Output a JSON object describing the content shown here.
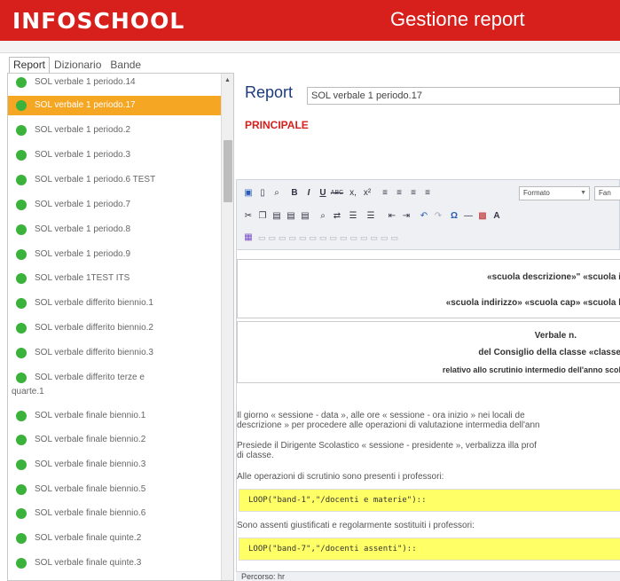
{
  "header": {
    "logo": "INFOSCHOOL",
    "title": "Gestione report",
    "colors": {
      "header_bg": "#d7201c",
      "selected_item": "#f5a623",
      "status_dot": "#3bb23b",
      "code_bg": "#ffff66"
    }
  },
  "tabs": [
    {
      "label": "Report",
      "active": true
    },
    {
      "label": "Dizionario",
      "active": false
    },
    {
      "label": "Bande",
      "active": false
    }
  ],
  "reports": [
    {
      "label": "SOL verbale 1 periodo.14"
    },
    {
      "label": "SOL verbale 1 periodo.17",
      "selected": true
    },
    {
      "label": "SOL verbale 1 periodo.2"
    },
    {
      "label": "SOL verbale 1 periodo.3"
    },
    {
      "label": "SOL verbale 1 periodo.6 TEST"
    },
    {
      "label": "SOL verbale 1 periodo.7"
    },
    {
      "label": "SOL verbale 1 periodo.8"
    },
    {
      "label": "SOL verbale 1 periodo.9"
    },
    {
      "label": "SOL verbale 1TEST ITS"
    },
    {
      "label": "SOL verbale differito biennio.1"
    },
    {
      "label": "SOL verbale differito biennio.2"
    },
    {
      "label": "SOL verbale differito biennio.3"
    },
    {
      "label": "SOL verbale differito terze e",
      "label2": "quarte.1"
    },
    {
      "label": "SOL verbale finale biennio.1"
    },
    {
      "label": "SOL verbale finale biennio.2"
    },
    {
      "label": "SOL verbale finale biennio.3"
    },
    {
      "label": "SOL verbale finale biennio.5"
    },
    {
      "label": "SOL verbale finale biennio.6"
    },
    {
      "label": "SOL verbale finale quinte.2"
    },
    {
      "label": "SOL verbale finale quinte.3"
    }
  ],
  "editor": {
    "report_label": "Report",
    "report_name": "SOL verbale 1 periodo.17",
    "section": "PRINCIPALE",
    "format_select": "Formato",
    "font_select": "Fan",
    "toolbar_icons": {
      "row1": [
        "save-icon",
        "new-doc-icon",
        "preview-icon",
        "bold-icon",
        "italic-icon",
        "underline-icon",
        "strike-icon",
        "subscript-icon",
        "superscript-icon",
        "align-left-icon",
        "align-center-icon",
        "align-right-icon",
        "justify-icon"
      ],
      "row2": [
        "cut-icon",
        "copy-icon",
        "paste-icon",
        "paste-text-icon",
        "paste-word-icon",
        "find-icon",
        "replace-icon",
        "bullet-list-icon",
        "numbered-list-icon",
        "outdent-icon",
        "indent-icon",
        "undo-icon",
        "redo-icon",
        "special-char-icon",
        "hr-icon",
        "image-icon",
        "font-color-icon"
      ],
      "row3": [
        "table-icon"
      ]
    },
    "glyphs": {
      "bold": "B",
      "italic": "I",
      "underline": "U",
      "strike": "ABC",
      "sub": "x,",
      "sup": "x²",
      "cut": "✂",
      "undo": "↶",
      "redo": "↷",
      "omega": "Ω",
      "letter_a": "A"
    },
    "doc": {
      "line1": "«scuola descrizione»\" «scuola i",
      "line2": "«scuola indirizzo» «scuola cap» «scuola l",
      "verbale": "Verbale n.",
      "consiglio": "del Consiglio della classe «classe",
      "relativo": "relativo allo scrutinio intermedio dell'anno scol",
      "p1a": "Il giorno « sessione - data », alle ore « sessione - ora inizio » nei locali de",
      "p1b": "descrizione » per procedere alle operazioni di valutazione intermedia dell'ann",
      "p2a": "Presiede il Dirigente Scolastico « sessione - presidente », verbalizza illa prof",
      "p2b": "di classe.",
      "p3": "Alle operazioni di scrutinio sono presenti i professori:",
      "code1": "LOOP(\"band-1\",\"/docenti e materie\")::",
      "p4": "Sono assenti giustificati e regolarmente sostituiti i professori:",
      "code2": "LOOP(\"band-7\",\"/docenti assenti\")::"
    },
    "status": "Percorso: hr"
  }
}
